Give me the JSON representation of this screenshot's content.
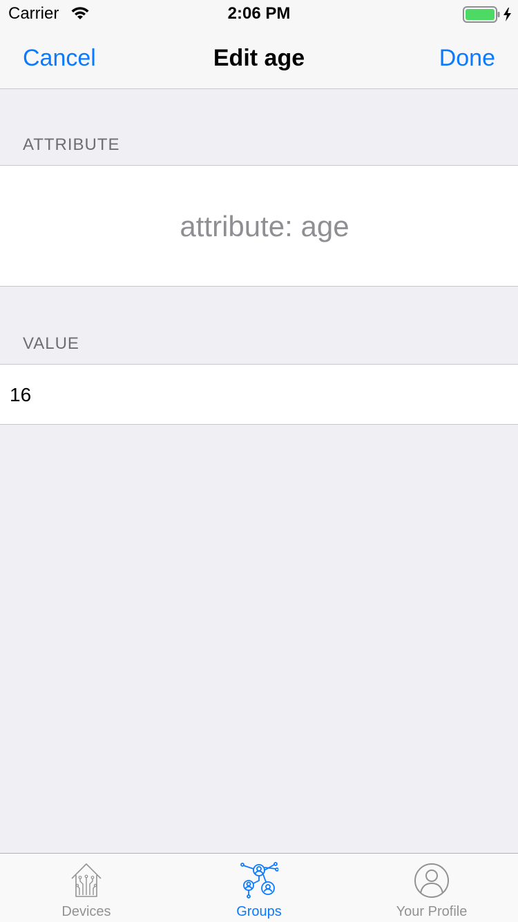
{
  "status_bar": {
    "carrier": "Carrier",
    "time": "2:06 PM",
    "battery_color": "#4cd964"
  },
  "nav": {
    "cancel_label": "Cancel",
    "title": "Edit age",
    "done_label": "Done"
  },
  "sections": {
    "attribute_header": "ATTRIBUTE",
    "attribute_value": "attribute: age",
    "value_header": "VALUE",
    "value_input": "16"
  },
  "tab_bar": {
    "tabs": [
      {
        "label": "Devices",
        "icon": "house-circuit-icon",
        "selected": false
      },
      {
        "label": "Groups",
        "icon": "people-network-icon",
        "selected": true
      },
      {
        "label": "Your Profile",
        "icon": "person-circle-icon",
        "selected": false
      }
    ],
    "active_color": "#0a7aff",
    "inactive_color": "#929292"
  }
}
